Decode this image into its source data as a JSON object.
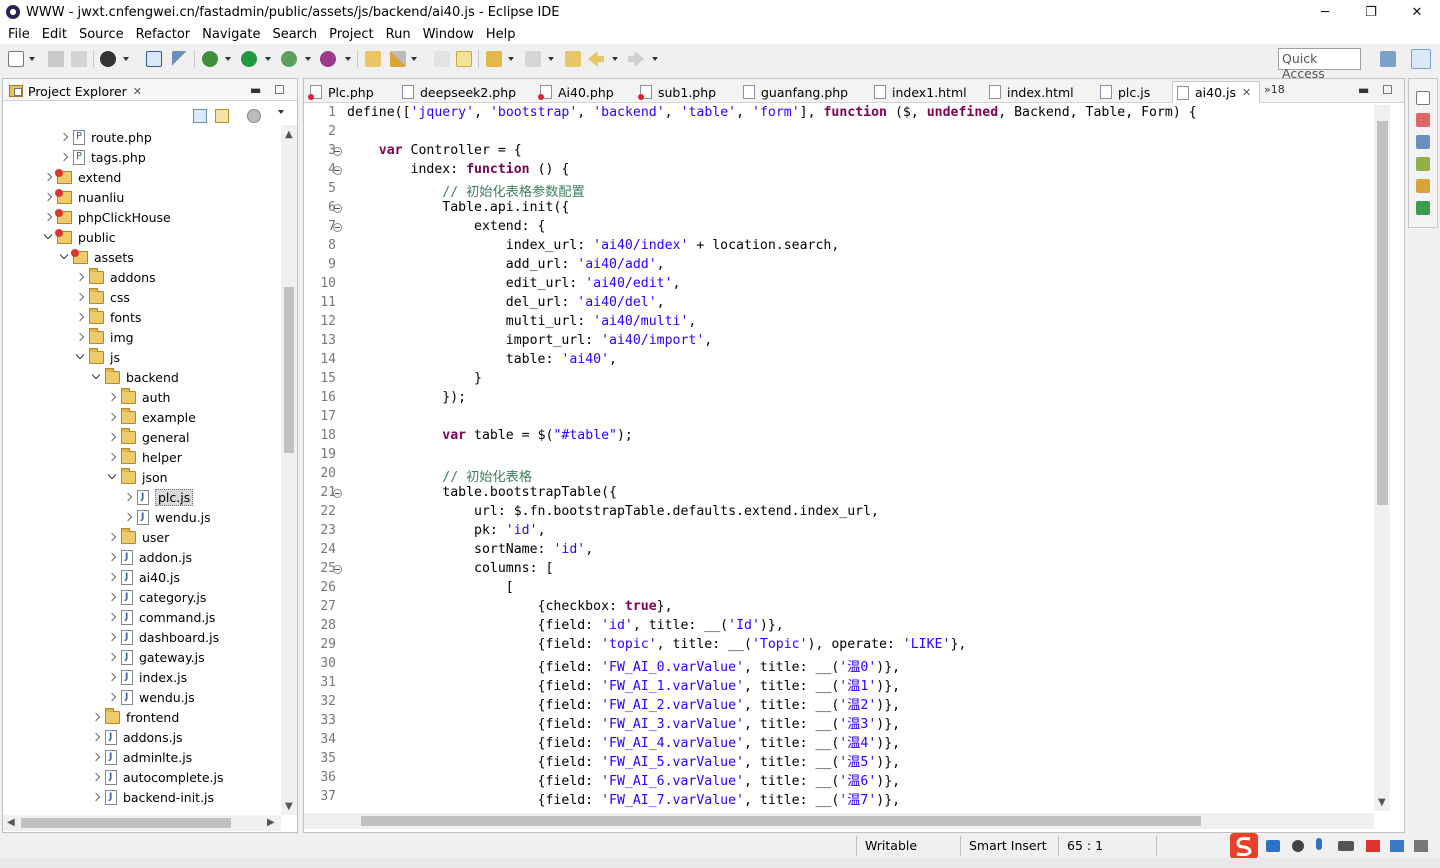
{
  "window": {
    "title": "WWW - jwxt.cnfengwei.cn/fastadmin/public/assets/js/backend/ai40.js - Eclipse IDE",
    "minimize": "─",
    "maximize": "❐",
    "close": "✕"
  },
  "menu": [
    "File",
    "Edit",
    "Source",
    "Refactor",
    "Navigate",
    "Search",
    "Project",
    "Run",
    "Window",
    "Help"
  ],
  "quick_access": "Quick Access",
  "explorer": {
    "tab_label": "Project Explorer",
    "close": "✕",
    "minimize": "▬",
    "maximize": "☐",
    "tree": [
      {
        "label": "route.php",
        "depth": 3,
        "icon": "php",
        "twisty": "collapsed"
      },
      {
        "label": "tags.php",
        "depth": 3,
        "icon": "php",
        "twisty": "collapsed"
      },
      {
        "label": "extend",
        "depth": 2,
        "icon": "pkg",
        "twisty": "collapsed"
      },
      {
        "label": "nuanliu",
        "depth": 2,
        "icon": "pkg",
        "twisty": "collapsed"
      },
      {
        "label": "phpClickHouse",
        "depth": 2,
        "icon": "pkg",
        "twisty": "collapsed"
      },
      {
        "label": "public",
        "depth": 2,
        "icon": "pkg",
        "twisty": "expanded"
      },
      {
        "label": "assets",
        "depth": 3,
        "icon": "pkg",
        "twisty": "expanded"
      },
      {
        "label": "addons",
        "depth": 4,
        "icon": "folder",
        "twisty": "collapsed"
      },
      {
        "label": "css",
        "depth": 4,
        "icon": "folder",
        "twisty": "collapsed"
      },
      {
        "label": "fonts",
        "depth": 4,
        "icon": "folder",
        "twisty": "collapsed"
      },
      {
        "label": "img",
        "depth": 4,
        "icon": "folder",
        "twisty": "collapsed"
      },
      {
        "label": "js",
        "depth": 4,
        "icon": "folder",
        "twisty": "expanded"
      },
      {
        "label": "backend",
        "depth": 5,
        "icon": "folder",
        "twisty": "expanded"
      },
      {
        "label": "auth",
        "depth": 6,
        "icon": "folder",
        "twisty": "collapsed"
      },
      {
        "label": "example",
        "depth": 6,
        "icon": "folder",
        "twisty": "collapsed"
      },
      {
        "label": "general",
        "depth": 6,
        "icon": "folder",
        "twisty": "collapsed"
      },
      {
        "label": "helper",
        "depth": 6,
        "icon": "folder",
        "twisty": "collapsed"
      },
      {
        "label": "json",
        "depth": 6,
        "icon": "folder",
        "twisty": "expanded"
      },
      {
        "label": "plc.js",
        "depth": 7,
        "icon": "js",
        "twisty": "collapsed",
        "selected": true
      },
      {
        "label": "wendu.js",
        "depth": 7,
        "icon": "js",
        "twisty": "collapsed"
      },
      {
        "label": "user",
        "depth": 6,
        "icon": "folder",
        "twisty": "collapsed"
      },
      {
        "label": "addon.js",
        "depth": 6,
        "icon": "js",
        "twisty": "collapsed"
      },
      {
        "label": "ai40.js",
        "depth": 6,
        "icon": "js",
        "twisty": "collapsed"
      },
      {
        "label": "category.js",
        "depth": 6,
        "icon": "js",
        "twisty": "collapsed"
      },
      {
        "label": "command.js",
        "depth": 6,
        "icon": "js",
        "twisty": "collapsed"
      },
      {
        "label": "dashboard.js",
        "depth": 6,
        "icon": "js",
        "twisty": "collapsed"
      },
      {
        "label": "gateway.js",
        "depth": 6,
        "icon": "js",
        "twisty": "collapsed"
      },
      {
        "label": "index.js",
        "depth": 6,
        "icon": "js",
        "twisty": "collapsed"
      },
      {
        "label": "wendu.js",
        "depth": 6,
        "icon": "js",
        "twisty": "collapsed"
      },
      {
        "label": "frontend",
        "depth": 5,
        "icon": "folder",
        "twisty": "collapsed"
      },
      {
        "label": "addons.js",
        "depth": 5,
        "icon": "js",
        "twisty": "collapsed"
      },
      {
        "label": "adminlte.js",
        "depth": 5,
        "icon": "js",
        "twisty": "collapsed"
      },
      {
        "label": "autocomplete.js",
        "depth": 5,
        "icon": "js",
        "twisty": "collapsed"
      },
      {
        "label": "backend-init.js",
        "depth": 5,
        "icon": "js",
        "twisty": "collapsed"
      }
    ]
  },
  "editor": {
    "tabs": [
      {
        "label": "Plc.php",
        "error": true
      },
      {
        "label": "deepseek2.php",
        "error": false
      },
      {
        "label": "Ai40.php",
        "error": true
      },
      {
        "label": "sub1.php",
        "error": true
      },
      {
        "label": "guanfang.php",
        "error": false
      },
      {
        "label": "index1.html",
        "error": false
      },
      {
        "label": "index.html",
        "error": false
      },
      {
        "label": "plc.js",
        "error": false
      },
      {
        "label": "ai40.js",
        "error": false,
        "active": true
      }
    ],
    "active_close": "✕",
    "overflow": "»18",
    "lines": [
      {
        "n": "1",
        "fold": false,
        "segs": [
          [
            "t",
            "define(["
          ],
          [
            "s",
            "'jquery'"
          ],
          [
            "t",
            ", "
          ],
          [
            "s",
            "'bootstrap'"
          ],
          [
            "t",
            ", "
          ],
          [
            "s",
            "'backend'"
          ],
          [
            "t",
            ", "
          ],
          [
            "s",
            "'table'"
          ],
          [
            "t",
            ", "
          ],
          [
            "s",
            "'form'"
          ],
          [
            "t",
            "], "
          ],
          [
            "k",
            "function"
          ],
          [
            "t",
            " ($, "
          ],
          [
            "k",
            "undefined"
          ],
          [
            "t",
            ", Backend, Table, Form) {"
          ]
        ]
      },
      {
        "n": "2",
        "fold": false,
        "segs": []
      },
      {
        "n": "3",
        "fold": true,
        "segs": [
          [
            "t",
            "    "
          ],
          [
            "k",
            "var"
          ],
          [
            "t",
            " Controller = {"
          ]
        ]
      },
      {
        "n": "4",
        "fold": true,
        "segs": [
          [
            "t",
            "        index: "
          ],
          [
            "k",
            "function"
          ],
          [
            "t",
            " () {"
          ]
        ]
      },
      {
        "n": "5",
        "fold": false,
        "segs": [
          [
            "t",
            "            "
          ],
          [
            "c",
            "// 初始化表格参数配置"
          ]
        ]
      },
      {
        "n": "6",
        "fold": true,
        "segs": [
          [
            "t",
            "            Table.api.init({"
          ]
        ]
      },
      {
        "n": "7",
        "fold": true,
        "segs": [
          [
            "t",
            "                extend: {"
          ]
        ]
      },
      {
        "n": "8",
        "fold": false,
        "segs": [
          [
            "t",
            "                    index_url: "
          ],
          [
            "s",
            "'ai40/index'"
          ],
          [
            "t",
            " + location.search,"
          ]
        ]
      },
      {
        "n": "9",
        "fold": false,
        "segs": [
          [
            "t",
            "                    add_url: "
          ],
          [
            "s",
            "'ai40/add'"
          ],
          [
            "t",
            ","
          ]
        ]
      },
      {
        "n": "10",
        "fold": false,
        "segs": [
          [
            "t",
            "                    edit_url: "
          ],
          [
            "s",
            "'ai40/edit'"
          ],
          [
            "t",
            ","
          ]
        ]
      },
      {
        "n": "11",
        "fold": false,
        "segs": [
          [
            "t",
            "                    del_url: "
          ],
          [
            "s",
            "'ai40/del'"
          ],
          [
            "t",
            ","
          ]
        ]
      },
      {
        "n": "12",
        "fold": false,
        "segs": [
          [
            "t",
            "                    multi_url: "
          ],
          [
            "s",
            "'ai40/multi'"
          ],
          [
            "t",
            ","
          ]
        ]
      },
      {
        "n": "13",
        "fold": false,
        "segs": [
          [
            "t",
            "                    import_url: "
          ],
          [
            "s",
            "'ai40/import'"
          ],
          [
            "t",
            ","
          ]
        ]
      },
      {
        "n": "14",
        "fold": false,
        "segs": [
          [
            "t",
            "                    table: "
          ],
          [
            "s",
            "'ai40'"
          ],
          [
            "t",
            ","
          ]
        ]
      },
      {
        "n": "15",
        "fold": false,
        "segs": [
          [
            "t",
            "                }"
          ]
        ]
      },
      {
        "n": "16",
        "fold": false,
        "segs": [
          [
            "t",
            "            });"
          ]
        ]
      },
      {
        "n": "17",
        "fold": false,
        "segs": []
      },
      {
        "n": "18",
        "fold": false,
        "segs": [
          [
            "t",
            "            "
          ],
          [
            "k",
            "var"
          ],
          [
            "t",
            " table = $("
          ],
          [
            "s",
            "\"#table\""
          ],
          [
            "t",
            ");"
          ]
        ]
      },
      {
        "n": "19",
        "fold": false,
        "segs": []
      },
      {
        "n": "20",
        "fold": false,
        "segs": [
          [
            "t",
            "            "
          ],
          [
            "c",
            "// 初始化表格"
          ]
        ]
      },
      {
        "n": "21",
        "fold": true,
        "segs": [
          [
            "t",
            "            table.bootstrapTable({"
          ]
        ]
      },
      {
        "n": "22",
        "fold": false,
        "segs": [
          [
            "t",
            "                url: $.fn.bootstrapTable.defaults.extend.index_url,"
          ]
        ]
      },
      {
        "n": "23",
        "fold": false,
        "segs": [
          [
            "t",
            "                pk: "
          ],
          [
            "s",
            "'id'"
          ],
          [
            "t",
            ","
          ]
        ]
      },
      {
        "n": "24",
        "fold": false,
        "segs": [
          [
            "t",
            "                sortName: "
          ],
          [
            "s",
            "'id'"
          ],
          [
            "t",
            ","
          ]
        ]
      },
      {
        "n": "25",
        "fold": true,
        "segs": [
          [
            "t",
            "                columns: ["
          ]
        ]
      },
      {
        "n": "26",
        "fold": false,
        "segs": [
          [
            "t",
            "                    ["
          ]
        ]
      },
      {
        "n": "27",
        "fold": false,
        "segs": [
          [
            "t",
            "                        {checkbox: "
          ],
          [
            "k",
            "true"
          ],
          [
            "t",
            "},"
          ]
        ]
      },
      {
        "n": "28",
        "fold": false,
        "segs": [
          [
            "t",
            "                        {field: "
          ],
          [
            "s",
            "'id'"
          ],
          [
            "t",
            ", title: __("
          ],
          [
            "s",
            "'Id'"
          ],
          [
            "t",
            ")},"
          ]
        ]
      },
      {
        "n": "29",
        "fold": false,
        "segs": [
          [
            "t",
            "                        {field: "
          ],
          [
            "s",
            "'topic'"
          ],
          [
            "t",
            ", title: __("
          ],
          [
            "s",
            "'Topic'"
          ],
          [
            "t",
            "), operate: "
          ],
          [
            "s",
            "'LIKE'"
          ],
          [
            "t",
            "},"
          ]
        ]
      },
      {
        "n": "30",
        "fold": false,
        "segs": [
          [
            "t",
            "                        {field: "
          ],
          [
            "s",
            "'FW_AI_0.varValue'"
          ],
          [
            "t",
            ", title: __("
          ],
          [
            "s",
            "'温0'"
          ],
          [
            "t",
            ")},"
          ]
        ]
      },
      {
        "n": "31",
        "fold": false,
        "segs": [
          [
            "t",
            "                        {field: "
          ],
          [
            "s",
            "'FW_AI_1.varValue'"
          ],
          [
            "t",
            ", title: __("
          ],
          [
            "s",
            "'温1'"
          ],
          [
            "t",
            ")},"
          ]
        ]
      },
      {
        "n": "32",
        "fold": false,
        "segs": [
          [
            "t",
            "                        {field: "
          ],
          [
            "s",
            "'FW_AI_2.varValue'"
          ],
          [
            "t",
            ", title: __("
          ],
          [
            "s",
            "'温2'"
          ],
          [
            "t",
            ")},"
          ]
        ]
      },
      {
        "n": "33",
        "fold": false,
        "segs": [
          [
            "t",
            "                        {field: "
          ],
          [
            "s",
            "'FW_AI_3.varValue'"
          ],
          [
            "t",
            ", title: __("
          ],
          [
            "s",
            "'温3'"
          ],
          [
            "t",
            ")},"
          ]
        ]
      },
      {
        "n": "34",
        "fold": false,
        "segs": [
          [
            "t",
            "                        {field: "
          ],
          [
            "s",
            "'FW_AI_4.varValue'"
          ],
          [
            "t",
            ", title: __("
          ],
          [
            "s",
            "'温4'"
          ],
          [
            "t",
            ")},"
          ]
        ]
      },
      {
        "n": "35",
        "fold": false,
        "segs": [
          [
            "t",
            "                        {field: "
          ],
          [
            "s",
            "'FW_AI_5.varValue'"
          ],
          [
            "t",
            ", title: __("
          ],
          [
            "s",
            "'温5'"
          ],
          [
            "t",
            ")},"
          ]
        ]
      },
      {
        "n": "36",
        "fold": false,
        "segs": [
          [
            "t",
            "                        {field: "
          ],
          [
            "s",
            "'FW_AI_6.varValue'"
          ],
          [
            "t",
            ", title: __("
          ],
          [
            "s",
            "'温6'"
          ],
          [
            "t",
            ")},"
          ]
        ]
      },
      {
        "n": "37",
        "fold": false,
        "segs": [
          [
            "t",
            "                        {field: "
          ],
          [
            "s",
            "'FW_AI_7.varValue'"
          ],
          [
            "t",
            ", title: __("
          ],
          [
            "s",
            "'温7'"
          ],
          [
            "t",
            ")},"
          ]
        ]
      }
    ]
  },
  "status": {
    "writable": "Writable",
    "insert_mode": "Smart Insert",
    "cursor": "65 : 1"
  },
  "colors": {
    "keyword": "#7f0055",
    "string": "#2a00ff",
    "comment": "#3f7f5f",
    "line_number": "#787878"
  }
}
